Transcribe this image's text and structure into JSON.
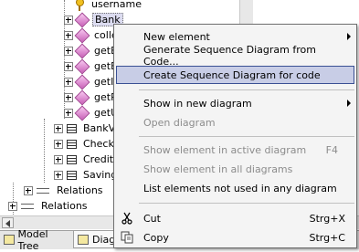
{
  "tree": {
    "items": [
      {
        "label": "username",
        "icon": "key-icon"
      },
      {
        "label": "Bank",
        "icon": "operation-icon",
        "selected": true
      },
      {
        "label": "collec",
        "icon": "operation-icon"
      },
      {
        "label": "getBa",
        "icon": "operation-icon"
      },
      {
        "label": "getBa",
        "icon": "operation-icon"
      },
      {
        "label": "getIPA",
        "icon": "operation-icon"
      },
      {
        "label": "getPa",
        "icon": "operation-icon"
      },
      {
        "label": "getUs",
        "icon": "operation-icon"
      },
      {
        "label": "BankVie",
        "icon": "class-icon"
      },
      {
        "label": "Checkin",
        "icon": "class-icon"
      },
      {
        "label": "CreditCa",
        "icon": "class-icon"
      },
      {
        "label": "Savings",
        "icon": "class-icon"
      },
      {
        "label": "Relations",
        "icon": "relations-icon"
      },
      {
        "label": "Relations",
        "icon": "relations-icon"
      }
    ]
  },
  "tabs": [
    {
      "label": "Model Tree"
    },
    {
      "label": "Diagr"
    }
  ],
  "context_menu": {
    "items": [
      {
        "label": "New element",
        "submenu": true
      },
      {
        "label": "Generate Sequence Diagram from Code..."
      },
      {
        "label": "Create Sequence Diagram for code",
        "highlighted": true
      },
      {
        "label": "Show in new diagram",
        "submenu": true
      },
      {
        "label": "Open diagram",
        "disabled": true
      },
      {
        "label": "Show element in active diagram",
        "shortcut": "F4",
        "disabled": true
      },
      {
        "label": "Show element in all diagrams",
        "disabled": true
      },
      {
        "label": "List elements not used in any diagram"
      },
      {
        "label": "Cut",
        "shortcut": "Strg+X",
        "icon": "scissors-icon"
      },
      {
        "label": "Copy",
        "shortcut": "Strg+C",
        "icon": "copy-icon"
      }
    ]
  },
  "colors": {
    "highlight_bg": "#c8cde6",
    "highlight_border": "#3a5094",
    "disabled_text": "#8c8c8c",
    "selected_item_bg": "#dcdcf0"
  }
}
